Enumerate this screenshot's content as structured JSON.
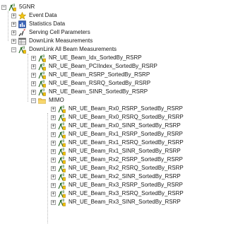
{
  "tree": {
    "root": {
      "label": "5GNR",
      "icon": "antenna-icon"
    },
    "items": [
      {
        "label": "Event Data",
        "icon": "star-icon"
      },
      {
        "label": "Statistics Data",
        "icon": "statistics-icon"
      },
      {
        "label": "Serving Cell Parameters",
        "icon": "signal-icon"
      },
      {
        "label": "DownLink Measurements",
        "icon": "measurement-table-icon"
      },
      {
        "label": "DownLink All Beam Measurements",
        "icon": "antenna-icon"
      }
    ],
    "beam_items": [
      {
        "label": "NR_UE_Beam_Idx_SortedBy_RSRP"
      },
      {
        "label": "NR_UE_Beam_PCIIndex_SortedBy_RSRP"
      },
      {
        "label": "NR_UE_Beam_RSRP_SortedBy_RSRP"
      },
      {
        "label": "NR_UE_Beam_RSRQ_SortedBy_RSRP"
      },
      {
        "label": "NR_UE_Beam_SINR_SortedBy_RSRP"
      }
    ],
    "mimo_folder": {
      "label": "MIMO",
      "icon": "folder-icon"
    },
    "mimo_items": [
      {
        "label": "NR_UE_Beam_Rx0_RSRP_SortedBy_RSRP"
      },
      {
        "label": "NR_UE_Beam_Rx0_RSRQ_SortedBy_RSRP"
      },
      {
        "label": "NR_UE_Beam_Rx0_SINR_SortedBy_RSRP"
      },
      {
        "label": "NR_UE_Beam_Rx1_RSRP_SortedBy_RSRP"
      },
      {
        "label": "NR_UE_Beam_Rx1_RSRQ_SortedBy_RSRP"
      },
      {
        "label": "NR_UE_Beam_Rx1_SINR_SortedBy_RSRP"
      },
      {
        "label": "NR_UE_Beam_Rx2_RSRP_SortedBy_RSRP"
      },
      {
        "label": "NR_UE_Beam_Rx2_RSRQ_SortedBy_RSRP"
      },
      {
        "label": "NR_UE_Beam_Rx2_SINR_SortedBy_RSRP"
      },
      {
        "label": "NR_UE_Beam_Rx3_RSRP_SortedBy_RSRP"
      },
      {
        "label": "NR_UE_Beam_Rx3_RSRQ_SortedBy_RSRP"
      },
      {
        "label": "NR_UE_Beam_Rx3_SINR_SortedBy_RSRP"
      }
    ],
    "expander_collapsed": "+",
    "expander_expanded": "−"
  }
}
